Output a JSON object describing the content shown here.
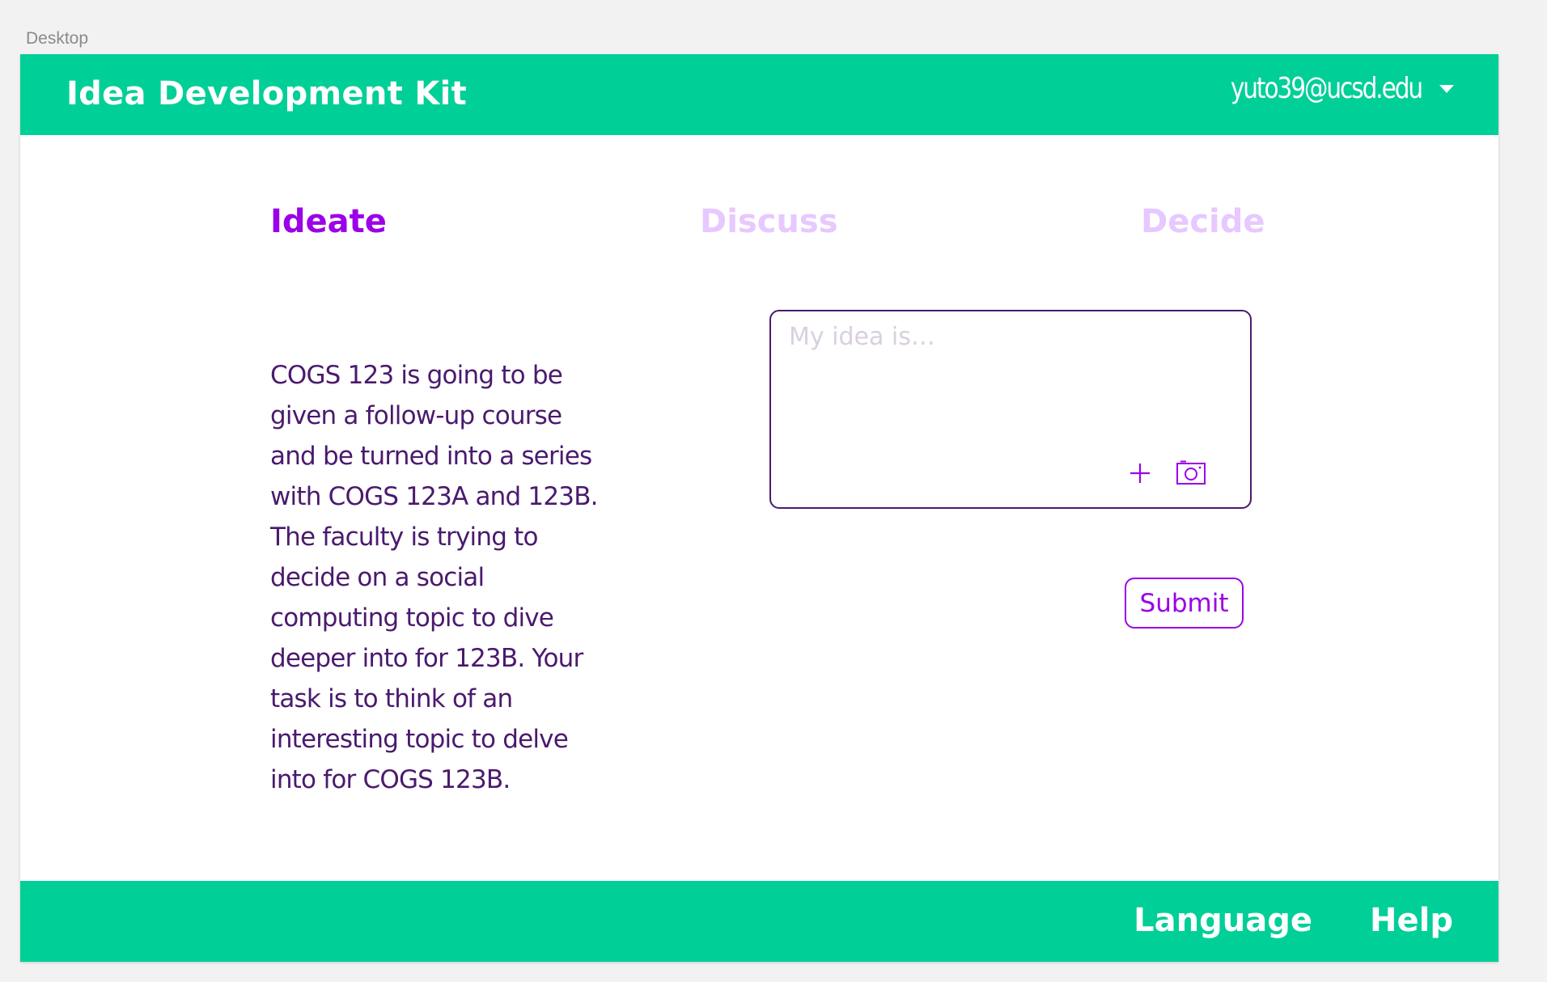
{
  "canvas": {
    "label": "Desktop"
  },
  "header": {
    "title": "Idea Development Kit",
    "user_email": "yuto39@ucsd.edu",
    "menu_icon": "chevron-down-icon"
  },
  "tabs": [
    {
      "label": "Ideate",
      "active": true
    },
    {
      "label": "Discuss",
      "active": false
    },
    {
      "label": "Decide",
      "active": false
    }
  ],
  "prompt": {
    "text": "COGS 123 is going to be given a follow-up course and be turned into a series with COGS 123A and 123B. The faculty is trying to decide on a social computing topic to dive deeper into for 123B. Your task is to think of an interesting topic to delve into for COGS 123B."
  },
  "idea_form": {
    "placeholder": "My idea is…",
    "value": "",
    "add_icon": "plus-icon",
    "camera_icon": "camera-icon",
    "submit_label": "Submit"
  },
  "footer": {
    "language_label": "Language",
    "help_label": "Help"
  },
  "colors": {
    "brand_green": "#00cf97",
    "accent_purple": "#9b00e8",
    "inactive_tab": "#e7c8ff",
    "text_dark_purple": "#4a1a6e",
    "background": "#f2f2f2"
  }
}
